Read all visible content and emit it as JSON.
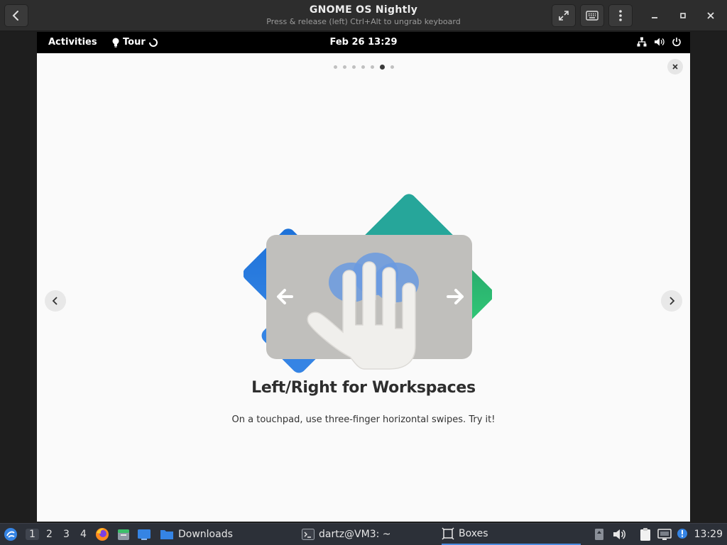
{
  "window": {
    "title": "GNOME OS Nightly",
    "subtitle": "Press & release (left) Ctrl+Alt to ungrab keyboard",
    "back_icon": "back-arrow-icon",
    "fullscreen_icon": "fullscreen-icon",
    "keyboard_icon": "keyboard-icon",
    "menu_icon": "kebab-menu-icon",
    "minimize_icon": "minimize-icon",
    "maximize_icon": "maximize-icon",
    "close_icon": "close-icon"
  },
  "gnome_topbar": {
    "activities": "Activities",
    "app_name": "Tour",
    "clock": "Feb 26  13:29",
    "status_icons": [
      "network-icon",
      "volume-icon",
      "power-icon"
    ]
  },
  "tour": {
    "pages_total": 7,
    "current_page": 6,
    "title": "Left/Right for Workspaces",
    "description": "On a touchpad, use three-finger horizontal swipes. Try it!",
    "colors": {
      "blue": "#2a7ae2",
      "green": "#33d17a",
      "teal": "#26a69a",
      "pad": "#c0bfbc"
    }
  },
  "taskbar": {
    "workspaces": [
      "1",
      "2",
      "3",
      "4"
    ],
    "current_workspace": "1",
    "launchers": [
      "firefox-icon",
      "files-icon",
      "desktop-icon"
    ],
    "tasks": [
      {
        "label": "Downloads",
        "icon": "folder-icon",
        "active": false
      },
      {
        "label": "dartz@VM3: ~",
        "icon": "terminal-icon",
        "active": false
      },
      {
        "label": "Boxes",
        "icon": "boxes-icon",
        "active": true
      }
    ],
    "tray_icons": [
      "drive-icon",
      "volume-icon",
      "clipboard-icon",
      "display-icon",
      "notification-icon"
    ],
    "clock": "13:29"
  }
}
